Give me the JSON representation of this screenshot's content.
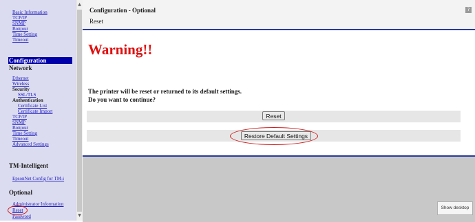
{
  "sidebar": {
    "general_links": [
      "Basic Information",
      "TCP/IP",
      "SNMP",
      "Bonjour",
      "Time Setting",
      "Timeout"
    ],
    "configuration_header": "Configuration",
    "network_header": "Network",
    "network_links": {
      "ethernet": "Ethernet",
      "wireless": "Wireless",
      "security": "Security",
      "ssl_tls": "SSL/TLS",
      "authentication": "Authentication",
      "certificate_list": "Certificate List",
      "certificate_import": "Certificate Import",
      "tcpip": "TCP/IP",
      "snmp": "SNMP",
      "bonjour": "Bonjour",
      "time_setting": "Time Setting",
      "timeout": "Timeout",
      "advanced_settings": "Advanced Settings"
    },
    "tm_intelligent_header": "TM-Intelligent",
    "epson_net_config": "EpsonNet Config for TM-i",
    "optional_header": "Optional",
    "optional_links": {
      "administrator_information": "Administrator Information",
      "reset": "Reset",
      "password": "Password"
    }
  },
  "header": {
    "title": "Configuration - Optional",
    "subtitle": "Reset",
    "help_icon": "?"
  },
  "main": {
    "warning": "Warning!!",
    "message_line1": "The printer will be reset or returned to its default settings.",
    "message_line2": "Do you want to continue?",
    "reset_button": "Reset",
    "restore_button": "Restore Default Settings"
  },
  "taskbar": {
    "show_desktop": "Show desktop"
  },
  "colors": {
    "sidebar_bg": "#dcdcf0",
    "link": "#2020c0",
    "accent_blue": "#0000aa",
    "warning_red": "#e01010",
    "highlight_ellipse": "#d01818"
  }
}
